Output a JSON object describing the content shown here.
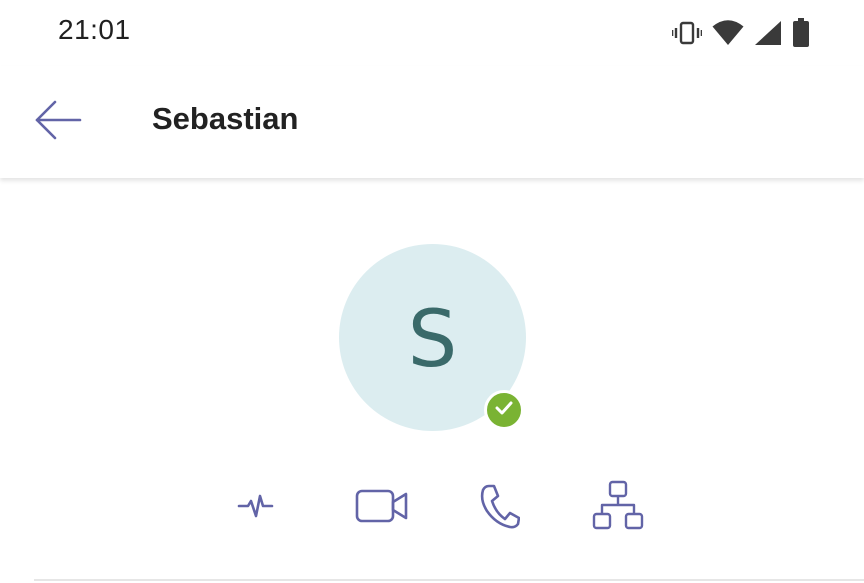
{
  "status_bar": {
    "time": "21:01",
    "icons": [
      "vibrate-icon",
      "wifi-icon",
      "cellular-signal-icon",
      "battery-icon"
    ]
  },
  "header": {
    "title": "Sebastian",
    "back_icon": "arrow-left-icon"
  },
  "profile": {
    "initial": "S",
    "presence": "available",
    "presence_icon": "checkmark-icon"
  },
  "actions": [
    {
      "name": "activity",
      "icon": "activity-pulse-icon"
    },
    {
      "name": "video-call",
      "icon": "video-camera-icon"
    },
    {
      "name": "audio-call",
      "icon": "phone-icon"
    },
    {
      "name": "org-chart",
      "icon": "org-chart-icon"
    }
  ],
  "colors": {
    "accent": "#6264a7",
    "presence_available": "#7ab333",
    "avatar_bg": "#dcedf0",
    "avatar_text": "#3a6a6a"
  }
}
